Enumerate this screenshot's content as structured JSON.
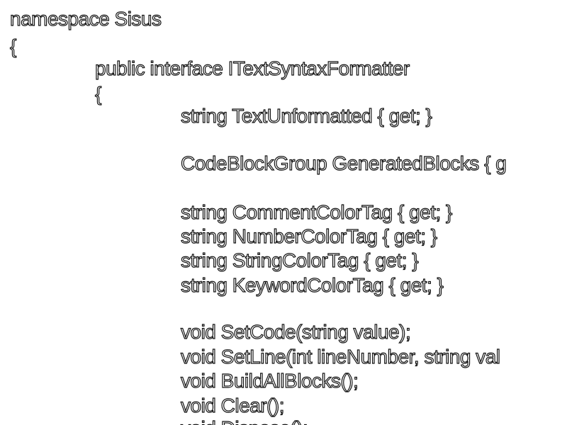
{
  "code": {
    "lines": [
      "namespace Sisus",
      "{",
      "public interface ITextSyntaxFormatter",
      "{",
      "string TextUnformatted { get; }",
      "CodeBlockGroup GeneratedBlocks { g",
      "string CommentColorTag { get; }",
      "string NumberColorTag { get; }",
      "string StringColorTag { get; }",
      "string KeywordColorTag { get; }",
      "void SetCode(string value);",
      "void SetLine(int lineNumber, string val",
      "void BuildAllBlocks();",
      "void Clear();",
      "void Dispose();"
    ]
  },
  "colors": {
    "background": "#ffffff",
    "text_fill": "#ffffff",
    "text_outline": "#111111"
  }
}
